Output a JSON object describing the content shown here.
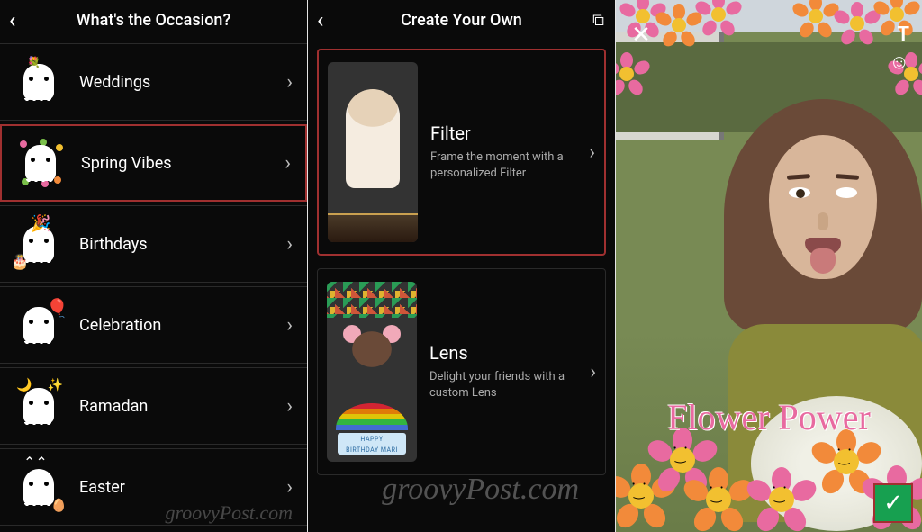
{
  "panel1": {
    "title": "What's the Occasion?",
    "items": [
      {
        "label": "Weddings",
        "selected": false
      },
      {
        "label": "Spring Vibes",
        "selected": true
      },
      {
        "label": "Birthdays",
        "selected": false
      },
      {
        "label": "Celebration",
        "selected": false
      },
      {
        "label": "Ramadan",
        "selected": false
      },
      {
        "label": "Easter",
        "selected": false
      }
    ]
  },
  "panel2": {
    "title": "Create Your Own",
    "cards": [
      {
        "title": "Filter",
        "desc": "Frame the moment with a personalized Filter",
        "selected": true
      },
      {
        "title": "Lens",
        "desc": "Delight your friends with a custom Lens",
        "selected": false
      }
    ]
  },
  "panel3": {
    "overlay_text": "Flower Power"
  },
  "watermark": "groovyPost.com",
  "icons": {
    "back": "‹",
    "chevron": "›",
    "copy": "⧉",
    "close": "✕",
    "text_tool": "T",
    "sticker_tool": "☺",
    "check": "✓"
  },
  "colors": {
    "highlight_border": "#a03030",
    "confirm_bg": "#17a050",
    "flower_pink": "#e86aa0",
    "flower_orange": "#f28a3a",
    "flower_center": "#f2c030"
  }
}
